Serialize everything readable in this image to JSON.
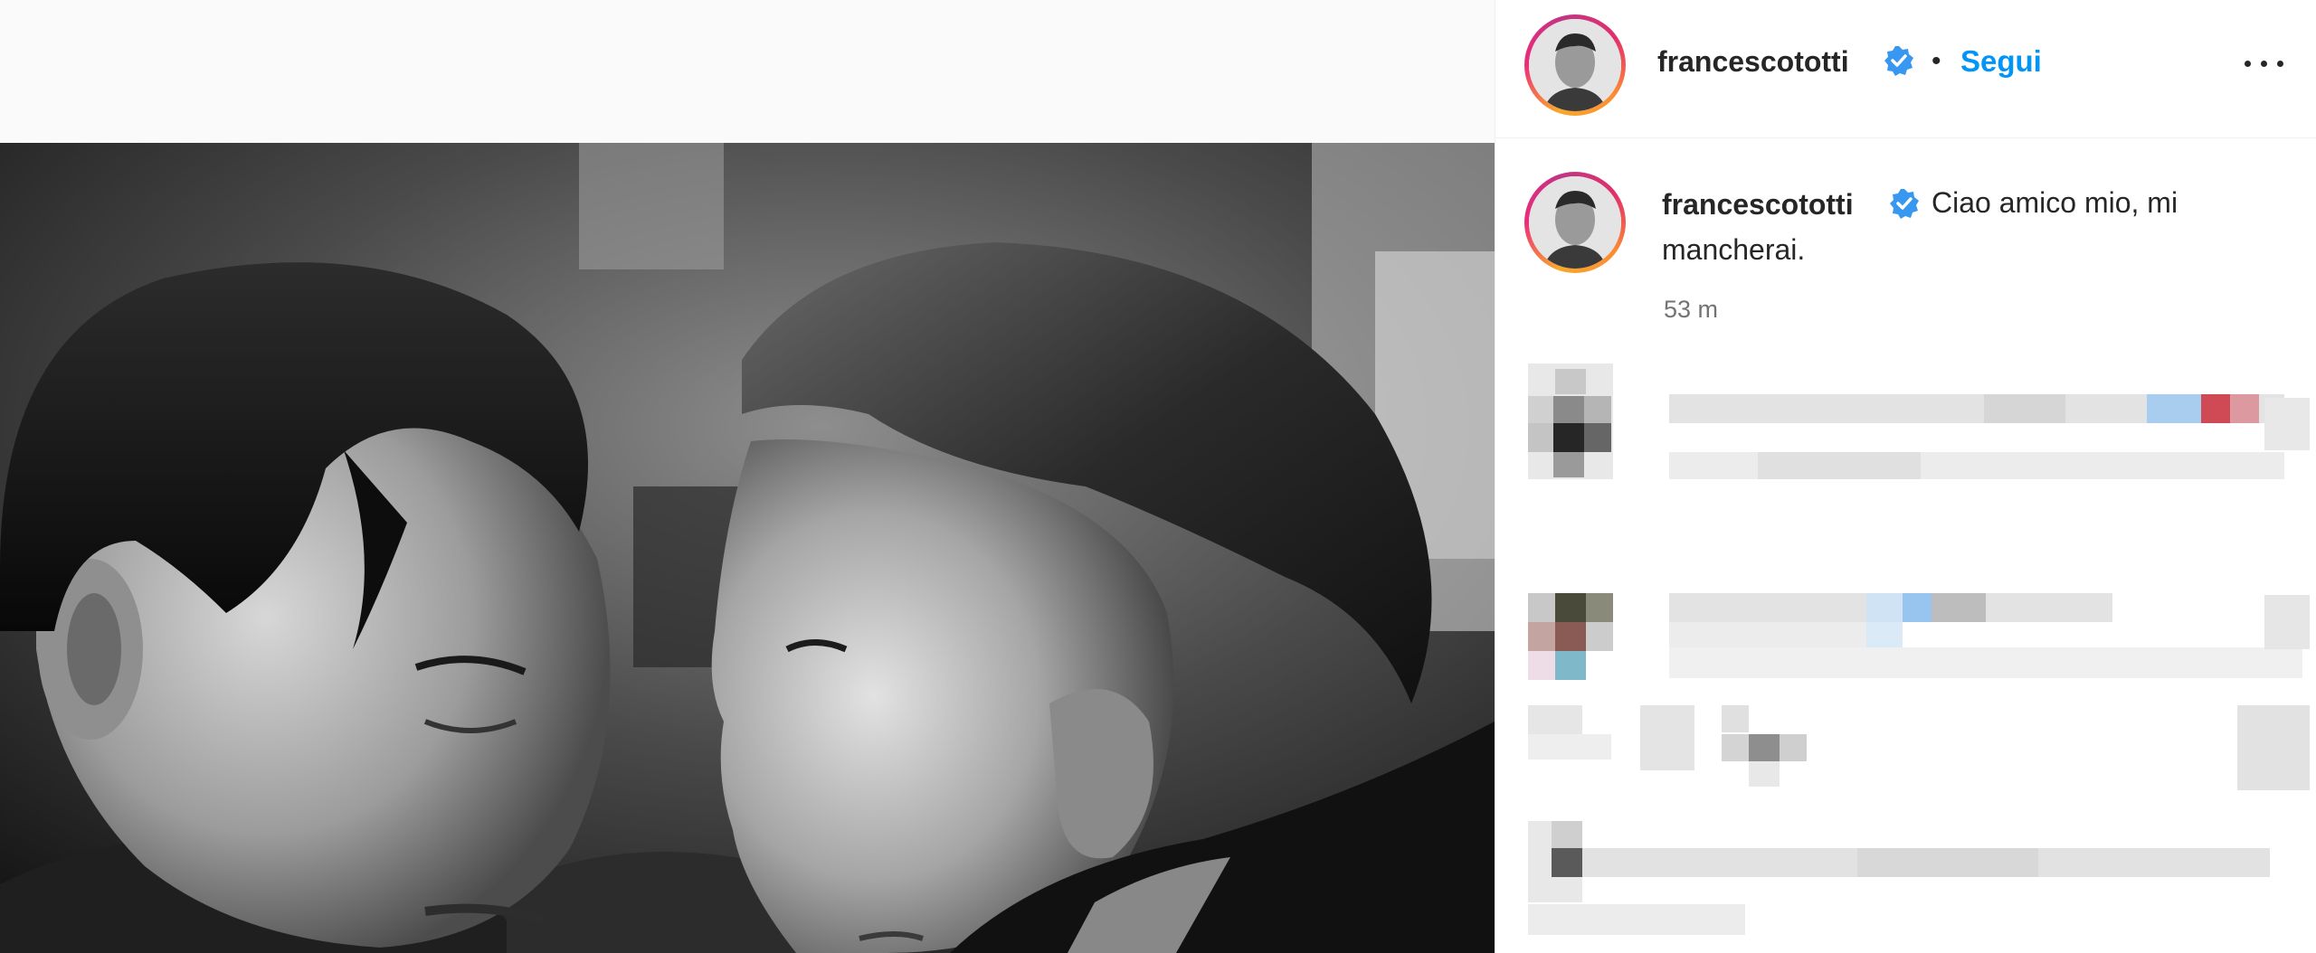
{
  "header": {
    "username": "francescototti",
    "separator": "•",
    "follow_label": "Segui",
    "more_icon": "more-horizontal-icon"
  },
  "caption": {
    "username": "francescototti",
    "text": "Ciao amico mio, mi mancherai.",
    "time": "53 m"
  },
  "colors": {
    "follow_blue": "#0095f6",
    "verified_blue": "#3897f0",
    "ring_start": "#f9a82b",
    "ring_end": "#c13584"
  },
  "icons": [
    "verified-badge-icon",
    "more-horizontal-icon"
  ]
}
